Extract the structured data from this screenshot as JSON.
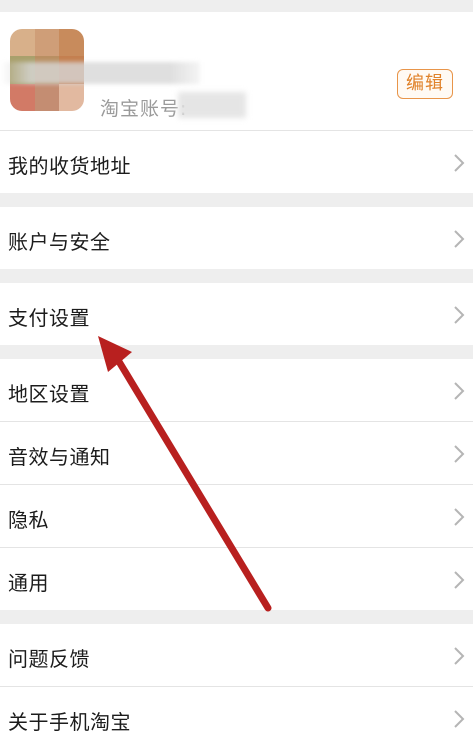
{
  "profile": {
    "account_label": "淘宝账号:",
    "edit_label": "编辑"
  },
  "sections": [
    {
      "items": [
        {
          "label": "我的收货地址"
        }
      ]
    },
    {
      "items": [
        {
          "label": "账户与安全"
        }
      ]
    },
    {
      "items": [
        {
          "label": "支付设置"
        }
      ]
    },
    {
      "items": [
        {
          "label": "地区设置"
        },
        {
          "label": "音效与通知"
        },
        {
          "label": "隐私"
        },
        {
          "label": "通用"
        }
      ]
    },
    {
      "items": [
        {
          "label": "问题反馈"
        },
        {
          "label": "关于手机淘宝"
        }
      ]
    }
  ],
  "annotation": {
    "arrow_color": "#b8201f"
  },
  "icons": {
    "row_chevron": "chevron-right-icon"
  }
}
